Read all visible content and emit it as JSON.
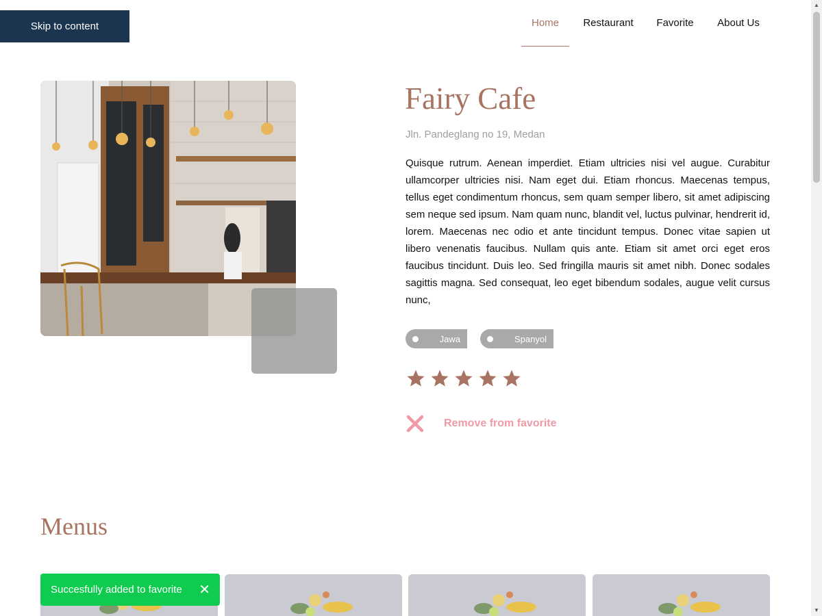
{
  "skip_link": "Skip to content",
  "nav": {
    "items": [
      {
        "label": "Home",
        "active": true
      },
      {
        "label": "Restaurant",
        "active": false
      },
      {
        "label": "Favorite",
        "active": false
      },
      {
        "label": "About Us",
        "active": false
      }
    ]
  },
  "restaurant": {
    "name": "Fairy Cafe",
    "address": "Jln. Pandeglang no 19, Medan",
    "description": "Quisque rutrum. Aenean imperdiet. Etiam ultricies nisi vel augue. Curabitur ullamcorper ultricies nisi. Nam eget dui. Etiam rhoncus. Maecenas tempus, tellus eget condimentum rhoncus, sem quam semper libero, sit amet adipiscing sem neque sed ipsum. Nam quam nunc, blandit vel, luctus pulvinar, hendrerit id, lorem. Maecenas nec odio et ante tincidunt tempus. Donec vitae sapien ut libero venenatis faucibus. Nullam quis ante. Etiam sit amet orci eget eros faucibus tincidunt. Duis leo. Sed fringilla mauris sit amet nibh. Donec sodales sagittis magna. Sed consequat, leo eget bibendum sodales, augue velit cursus nunc,",
    "categories": [
      "Jawa",
      "Spanyol"
    ],
    "rating": 5,
    "rating_max": 5
  },
  "favorite_button": {
    "label": "Remove from favorite",
    "icon": "close-icon"
  },
  "menus": {
    "title": "Menus"
  },
  "toast": {
    "message": "Succesfully added to favorite",
    "close_icon": "close-icon"
  },
  "colors": {
    "accent": "#a87461",
    "skip_link_bg": "#1b3550",
    "tag_bg": "#a9a9a9",
    "remove_fav": "#ef9aa6",
    "toast_bg": "#0fcb4f"
  }
}
